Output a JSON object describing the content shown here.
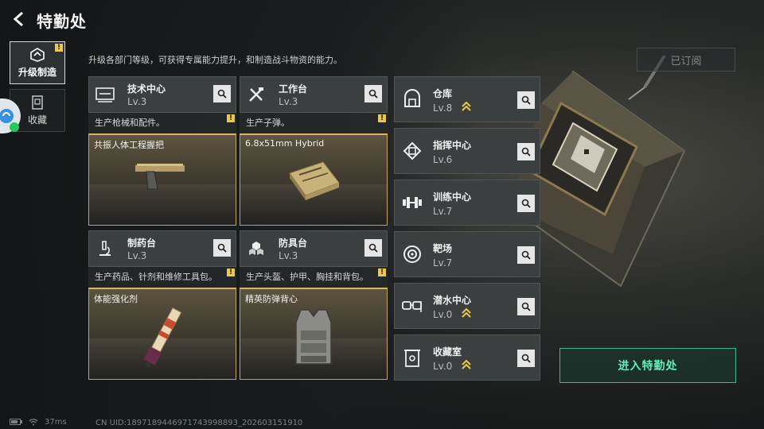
{
  "header": {
    "title": "特勤处"
  },
  "sidebar": {
    "tabs": [
      {
        "label": "升级制造",
        "active": true,
        "flag": "!"
      },
      {
        "label": "收藏",
        "active": false
      }
    ]
  },
  "description": "升级各部门等级，可获得专属能力提升，和制造战斗物资的能力。",
  "subscribed_label": "已订阅",
  "facilities": [
    {
      "name": "技术中心",
      "level": "Lv.3",
      "desc": "生产枪械和配件。",
      "product": "共振人体工程握把",
      "flag": "!"
    },
    {
      "name": "工作台",
      "level": "Lv.3",
      "desc": "生产子弹。",
      "product": "6.8x51mm Hybrid",
      "flag": "!"
    },
    {
      "name": "制药台",
      "level": "Lv.3",
      "desc": "生产药品、针剂和维修工具包。",
      "product": "体能强化剂",
      "flag": "!"
    },
    {
      "name": "防具台",
      "level": "Lv.3",
      "desc": "生产头盔、护甲、胸挂和背包。",
      "product": "精英防弹背心",
      "flag": "!"
    }
  ],
  "departments": [
    {
      "name": "仓库",
      "level": "Lv.8",
      "upgradable": true
    },
    {
      "name": "指挥中心",
      "level": "Lv.6",
      "upgradable": false
    },
    {
      "name": "训练中心",
      "level": "Lv.7",
      "upgradable": false
    },
    {
      "name": "靶场",
      "level": "Lv.7",
      "upgradable": false
    },
    {
      "name": "潜水中心",
      "level": "Lv.0",
      "upgradable": true
    },
    {
      "name": "收藏室",
      "level": "Lv.0",
      "upgradable": true
    }
  ],
  "enter_button": "进入特勤处",
  "status": {
    "ping": "37ms",
    "uid": "CN UID:1897189446971743998893_202603151910"
  },
  "colors": {
    "accent_gold": "#e9c84a",
    "accent_green": "#5ef0b8"
  }
}
